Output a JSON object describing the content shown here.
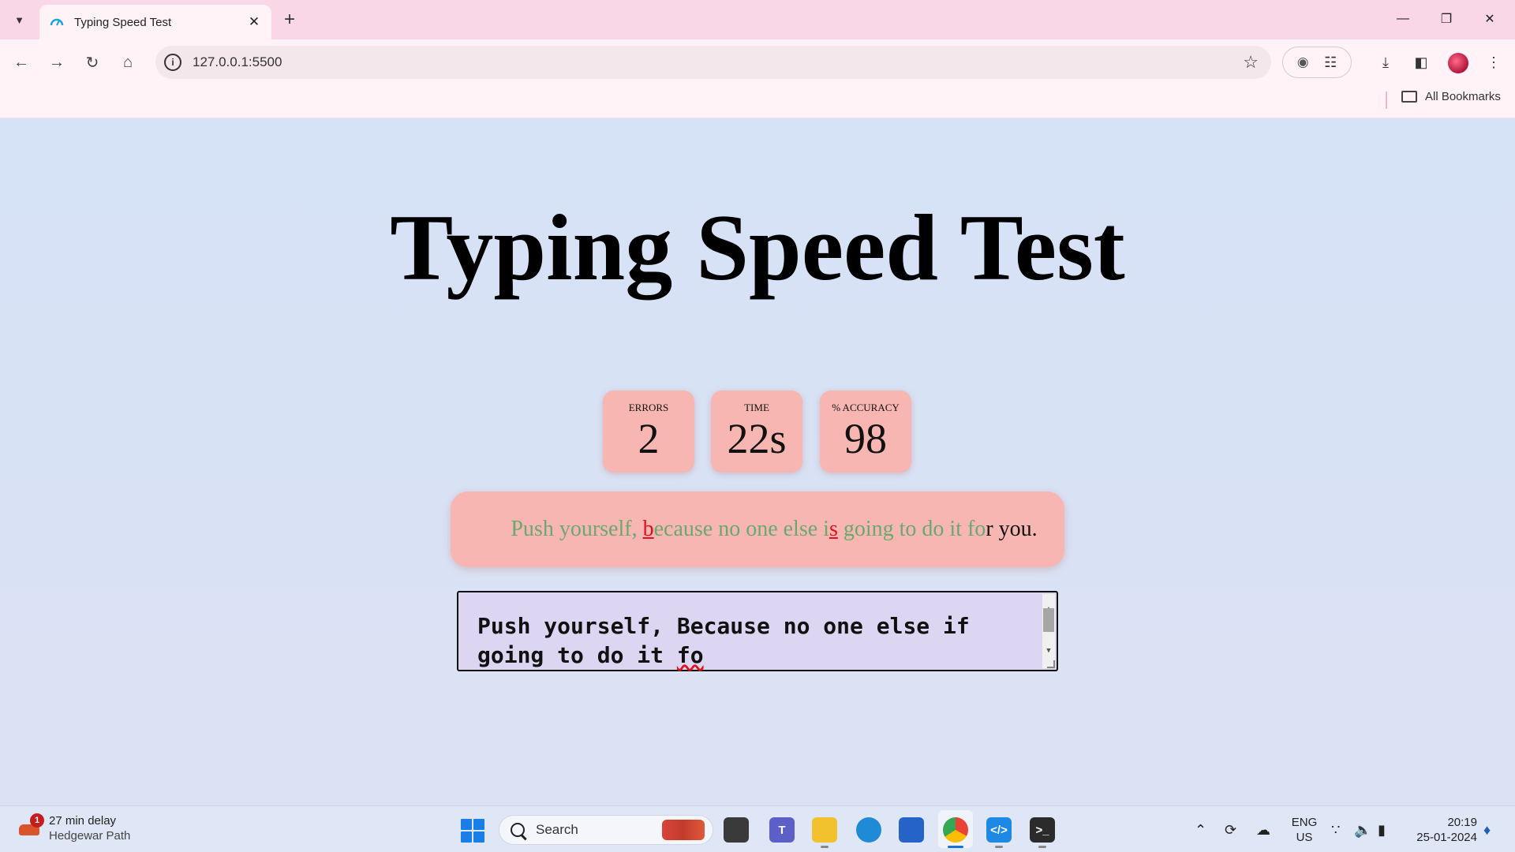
{
  "browser": {
    "tab_title": "Typing Speed Test",
    "url": "127.0.0.1:5500",
    "bookmarks_label": "All Bookmarks"
  },
  "page": {
    "title": "Typing Speed Test",
    "stats": [
      {
        "label": "ERRORS",
        "value": "2"
      },
      {
        "label": "TIME",
        "value": "22s"
      },
      {
        "label": "% ACCURACY",
        "value": "98"
      }
    ],
    "quote": {
      "correct_1": "Push yourself, ",
      "wrong_1": "b",
      "correct_2": "ecause no one else i",
      "wrong_2": "s",
      "correct_3": " going to do it fo",
      "pending": "r you."
    },
    "input": {
      "line1": "Push yourself, Because no one else if",
      "line2_prefix": "going to do it ",
      "line2_misspelled": "fo"
    }
  },
  "taskbar": {
    "weather_title": "27 min delay",
    "weather_sub": "Hedgewar Path",
    "weather_badge": "1",
    "search_label": "Search",
    "lang_top": "ENG",
    "lang_bottom": "US",
    "time": "20:19",
    "date": "25-01-2024"
  },
  "colors": {
    "card_bg": "#f8b6b2",
    "correct_text": "#6aa870",
    "error_text": "#e0101c",
    "input_bg": "#dcd6f3",
    "page_bg": "#d8e3f5"
  }
}
